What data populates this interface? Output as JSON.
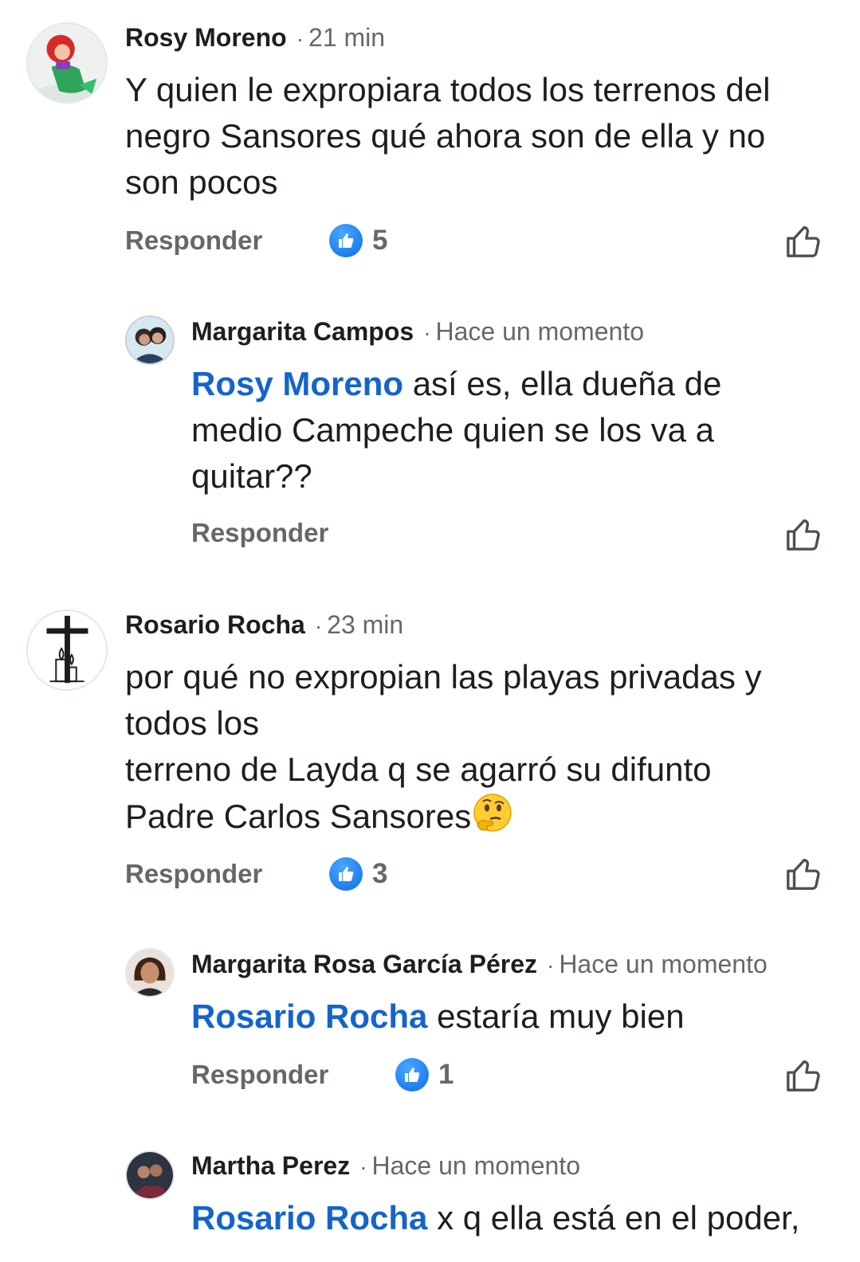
{
  "comments": [
    {
      "name": "Rosy Moreno",
      "time": "21 min",
      "text": "Y quien le expropiara todos los terrenos del\nnegro Sansores qué ahora son de ella y no\nson pocos",
      "reply_label": "Responder",
      "likes": "5"
    },
    {
      "name": "Margarita Campos",
      "time": "Hace un momento",
      "mention": "Rosy Moreno",
      "text": " así es, ella dueña de\nmedio Campeche quien se los va a\nquitar??",
      "reply_label": "Responder"
    },
    {
      "name": "Rosario Rocha",
      "time": "23 min",
      "text": "por qué no expropian las playas privadas y\ntodos los\nterreno de Layda q se agarró su difunto\nPadre Carlos Sansores",
      "emoji": "thinking-face",
      "reply_label": "Responder",
      "likes": "3"
    },
    {
      "name": "Margarita Rosa García Pérez",
      "time": "Hace un momento",
      "mention": "Rosario Rocha",
      "text": " estaría muy bien",
      "reply_label": "Responder",
      "likes": "1"
    },
    {
      "name": "Martha Perez",
      "time": "Hace un momento",
      "mention": "Rosario Rocha",
      "text": " x q ella está en el poder,"
    }
  ],
  "separator": "·",
  "colors": {
    "mention": "#1464cc",
    "secondary_text": "#65676b",
    "like_badge": "#0a6de8"
  }
}
